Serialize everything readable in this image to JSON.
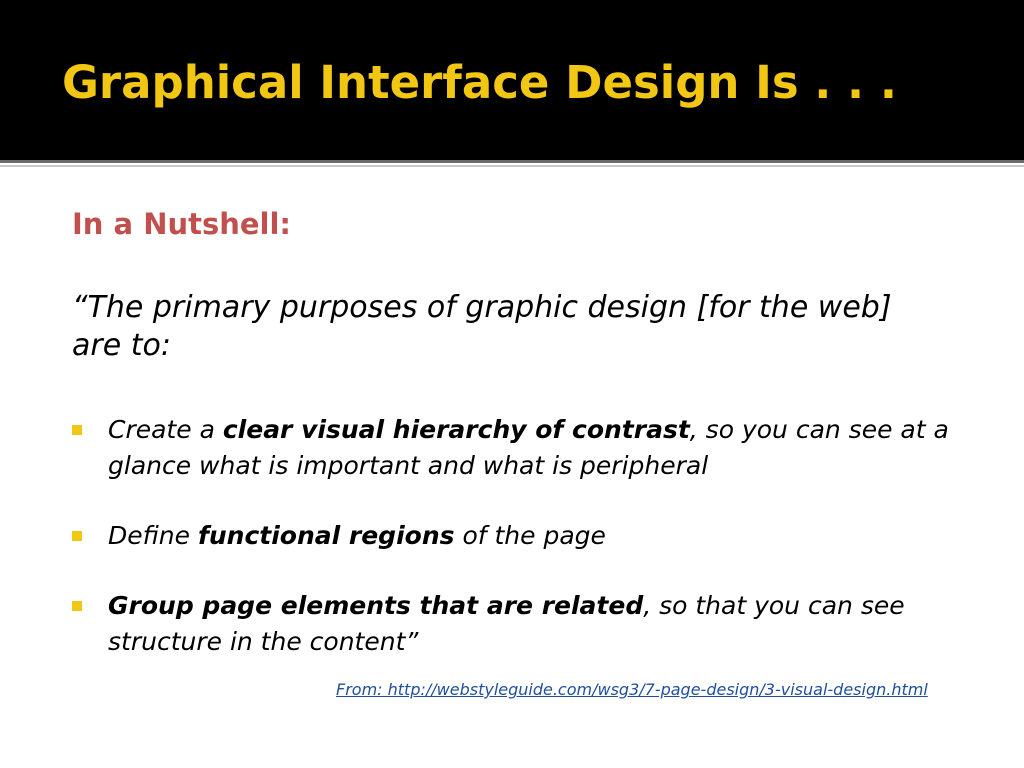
{
  "slide": {
    "title": "Graphical Interface Design Is . . .",
    "subheading": "In a Nutshell:",
    "quote": "“The primary purposes of graphic design [for the web] are to:",
    "bullets": [
      {
        "pre": "Create a ",
        "bold": "clear visual hierarchy of contrast",
        "post": ", so you can see at a glance what is important and what is peripheral"
      },
      {
        "pre": "Define ",
        "bold": "functional regions",
        "post": " of the page"
      },
      {
        "pre": "",
        "bold": "Group page elements that are related",
        "post": ", so that you can see structure in the content”"
      }
    ],
    "source": "From: http://webstyleguide.com/wsg3/7-page-design/3-visual-design.html"
  },
  "colors": {
    "title_bar": "#000000",
    "title_text": "#f2c714",
    "subheading_text": "#c0504d",
    "bullet_marker": "#f2c714",
    "link": "#1f4e9c"
  }
}
